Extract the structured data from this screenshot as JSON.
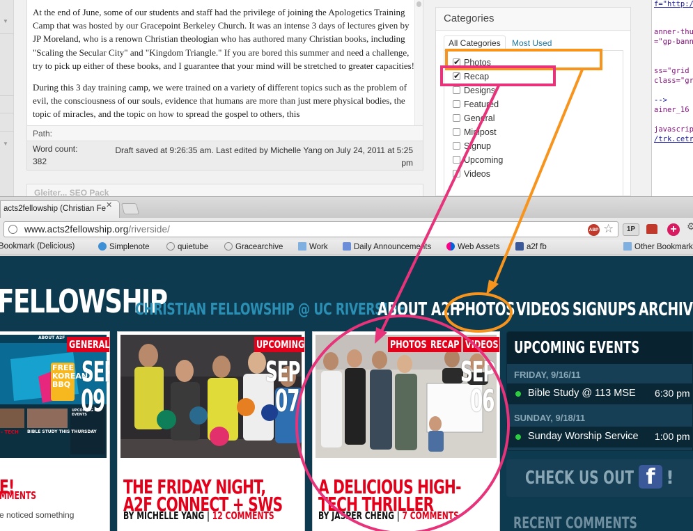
{
  "editor": {
    "paragraph1": "At the end of June, some of our students and staff had the privilege of  joining the Apologetics Training Camp that was hosted by our Gracepoint Berkeley Church.  It was an intense 3 days of lectures given by JP Moreland, who is a renown Christian theologian who has authored many Christian books, including \"Scaling the Secular City\" and \"Kingdom Triangle.\"  If you are bored this summer and need a challenge, try to pick up either of these books, and I guarantee that your mind will be stretched to greater capacities!",
    "paragraph2": "During this 3 day training camp, we were trained on a variety of different topics such as the problem of evil, the consciousness of our souls, evidence that humans are more than just mere physical bodies, the topic of miracles, and the topic on how to spread the gospel to others, this",
    "path_label": "Path:",
    "word_count_label": "Word count:",
    "word_count": "382",
    "draft_status": "Draft saved at 9:26:35 am. Last edited by Michelle Yang on July 24, 2011 at 5:25 pm",
    "below_box_title": "Gleiter... SEO Pack"
  },
  "categories": {
    "title": "Categories",
    "tabs": [
      "All Categories",
      "Most Used"
    ],
    "items": [
      {
        "label": "Photos",
        "checked": true
      },
      {
        "label": "Recap",
        "checked": true
      },
      {
        "label": "Designs",
        "checked": false
      },
      {
        "label": "Featured",
        "checked": false
      },
      {
        "label": "General",
        "checked": false
      },
      {
        "label": "Minipost",
        "checked": false
      },
      {
        "label": "Signup",
        "checked": false
      },
      {
        "label": "Upcoming",
        "checked": false
      },
      {
        "label": "Videos",
        "checked": false
      }
    ]
  },
  "code_pane": {
    "lines": [
      "f=\"http://www.a",
      "anner-thum",
      "=\"gp-bann",
      "ss=\"grid",
      "class=\"gr",
      "-->",
      "ainer_16",
      "javascrip",
      "/trk.cetr"
    ]
  },
  "browser": {
    "tab_title": "acts2fellowship (Christian Fe",
    "url_main": "www.acts2fellowship.org",
    "url_path": "/riverside/",
    "abp_label": "ABP",
    "ext_1p": "1P",
    "bookmarks": [
      "Bookmark (Delicious)",
      "Simplenote",
      "quietube",
      "Gracearchive",
      "Work",
      "Daily Announcements",
      "Web Assets",
      "a2f fb",
      "Other Bookmarks"
    ]
  },
  "site": {
    "brand": "FELLOWSHIP",
    "tagline": "CHRISTIAN FELLOWSHIP @ UC RIVERSIDE",
    "nav": [
      "ABOUT A2F",
      "PHOTOS",
      "VIDEOS",
      "SIGNUPS",
      "ARCHIVES"
    ],
    "posts": [
      {
        "categories": [
          "GENERAL"
        ],
        "month": "SEP",
        "day": "09",
        "title": "E!",
        "byline_author": "",
        "byline_comments": "MMENTS",
        "excerpt": "e noticed something"
      },
      {
        "categories": [
          "UPCOMING"
        ],
        "month": "SEP",
        "day": "07",
        "title": "THE FRIDAY NIGHT, A2F CONNECT + SWS",
        "byline_author": "BY MICHELLE YANG",
        "byline_comments": "12 COMMENTS"
      },
      {
        "categories": [
          "PHOTOS",
          "RECAP",
          "VIDEOS"
        ],
        "month": "SEP",
        "day": "06",
        "title": "A DELICIOUS HIGH-TECH THRILLER",
        "byline_author": "BY JASPER CHENG",
        "byline_comments": "7 COMMENTS"
      }
    ],
    "upcoming_events": {
      "title": "UPCOMING EVENTS",
      "days": [
        {
          "date": "FRIDAY, 9/16/11",
          "event": "Bible Study @ 113 MSE",
          "time": "6:30 pm"
        },
        {
          "date": "SUNDAY, 9/18/11",
          "event": "Sunday Worship Service",
          "time": "1:00 pm"
        }
      ]
    },
    "social": {
      "text": "CHECK US OUT ON",
      "icon": "facebook-icon",
      "suffix": "!"
    },
    "recent_comments": "RECENT COMMENTS",
    "thumb1_texts": [
      "FREE",
      "KOREAN",
      "BBQ",
      "BIBLE STUDY THIS THURSDAY",
      "UPCOMING EVENTS",
      "ABOUT A2F",
      "- TECH"
    ]
  },
  "colors": {
    "site_bg": "#0e3a50",
    "accent_red": "#e2001a",
    "tagline_blue": "#2b8fb4",
    "annotation_orange": "#f7941d",
    "annotation_pink": "#e6337a"
  }
}
